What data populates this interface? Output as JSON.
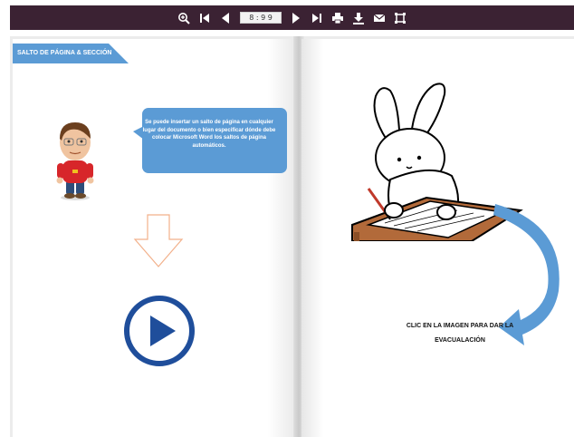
{
  "toolbar": {
    "page_indicator": "8 : 9 9",
    "icons": [
      "zoom-in-icon",
      "first-page-icon",
      "prev-page-icon",
      "next-page-icon",
      "last-page-icon",
      "print-icon",
      "download-icon",
      "email-icon",
      "fullscreen-icon"
    ],
    "background": "#3b2233"
  },
  "left_page": {
    "section_title": "SALTO DE PÁGINA & SECCIÓN",
    "bubble_text": "Se puede insertar un salto de página en cualquier lugar del documento o bien especificar dónde debe colocar Microsoft Word los saltos de página automáticos.",
    "colors": {
      "tag": "#5b9bd5",
      "bubble": "#5b9bd5",
      "play": "#1f4e9b",
      "arrow_outline": "#f2b08a"
    }
  },
  "right_page": {
    "caption_line1": "CLIC EN LA IMAGEN PARA DAR LA",
    "caption_line2": "EVACUALACIÓN",
    "colors": {
      "curve_arrow": "#5b9bd5"
    }
  }
}
